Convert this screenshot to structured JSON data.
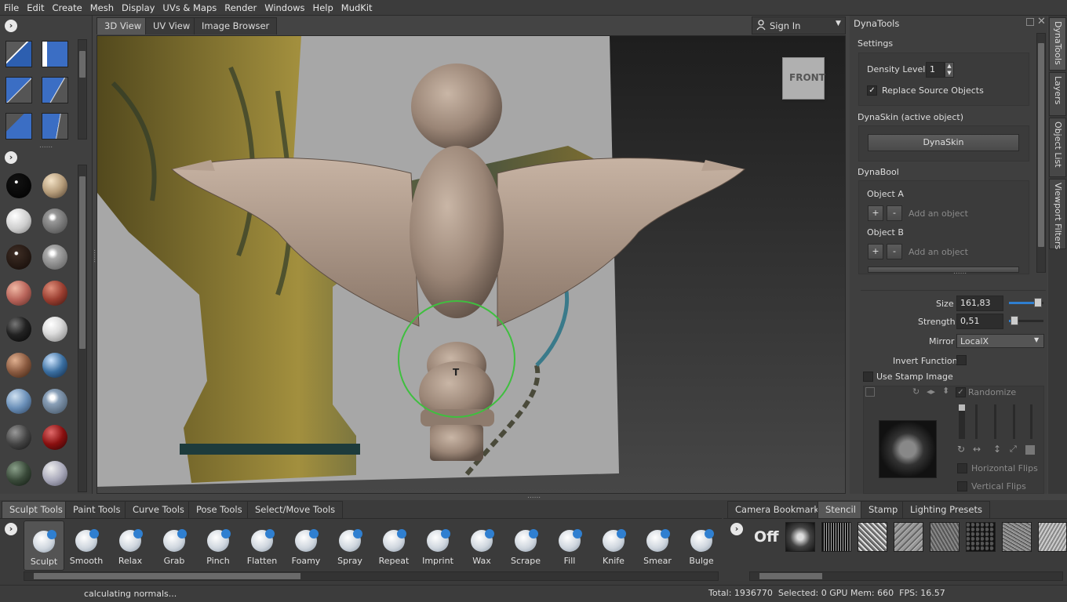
{
  "menu": [
    "File",
    "Edit",
    "Create",
    "Mesh",
    "Display",
    "UVs & Maps",
    "Render",
    "Windows",
    "Help",
    "MudKit"
  ],
  "view_tabs": [
    "3D View",
    "UV View",
    "Image Browser"
  ],
  "sign_in": "Sign In",
  "viewcube": "FRONT",
  "cursor_glyph": "T",
  "panel": {
    "title": "DynaTools",
    "settings_heading": "Settings",
    "density_label": "Density Level:",
    "density_value": "1",
    "replace_label": "Replace Source Objects",
    "replace_checked": "✓",
    "dynaskin_heading": "DynaSkin (active object)",
    "dynaskin_button": "DynaSkin",
    "dynabool_heading": "DynaBool",
    "object_a": "Object A",
    "object_b": "Object B",
    "add_object": "Add an object",
    "plus": "+",
    "minus": "-",
    "grip": "......"
  },
  "side_tabs": [
    "DynaTools",
    "Layers",
    "Object List",
    "Viewport Filters"
  ],
  "props": {
    "size_label": "Size",
    "size_value": "161,83",
    "size_level": 0.95,
    "strength_label": "Strength",
    "strength_value": "0,51",
    "strength_level": 0.05,
    "mirror_label": "Mirror",
    "mirror_value": "LocalX",
    "invert_label": "Invert Function",
    "stamp_label": "Use Stamp Image",
    "randomize_label": "Randomize",
    "hflips_label": "Horizontal Flips",
    "vflips_label": "Vertical Flips"
  },
  "tool_tabs": [
    "Sculpt Tools",
    "Paint Tools",
    "Curve Tools",
    "Pose Tools",
    "Select/Move Tools"
  ],
  "tools": [
    "Sculpt",
    "Smooth",
    "Relax",
    "Grab",
    "Pinch",
    "Flatten",
    "Foamy",
    "Spray",
    "Repeat",
    "Imprint",
    "Wax",
    "Scrape",
    "Fill",
    "Knife",
    "Smear",
    "Bulge"
  ],
  "stencil_tabs": [
    "Camera Bookmarks",
    "Stencil",
    "Stamp",
    "Lighting Presets"
  ],
  "stencil_off": "Off",
  "status": {
    "message": "calculating normals...",
    "stats": "Total: 1936770  Selected: 0 GPU Mem: 660  FPS: 16.57"
  },
  "colors": {
    "accent": "#2f7fd0",
    "brush_ring": "#3fbf3f"
  }
}
